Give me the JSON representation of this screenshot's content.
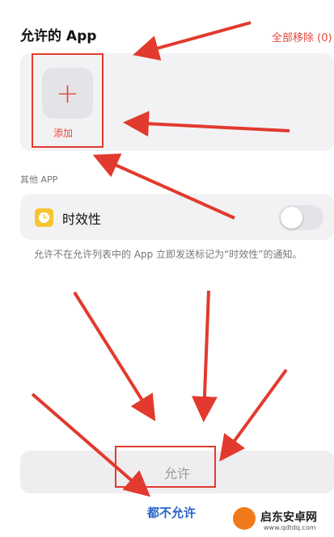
{
  "allowed_apps": {
    "title": "允许的 App",
    "remove_all_label": "全部移除 (0)",
    "add_button_symbol": "+",
    "add_label": "添加"
  },
  "other_apps": {
    "title": "其他 APP",
    "time_sensitive_label": "时效性",
    "time_sensitive_enabled": false,
    "description": "允许不在允许列表中的 App 立即发送标记为“时效性”的通知。"
  },
  "actions": {
    "allow_label": "允许",
    "deny_label": "都不允许"
  },
  "watermark": {
    "brand": "启东安卓网",
    "url": "www.qdtdq.com"
  },
  "colors": {
    "accent_red": "#e5463a",
    "link_blue": "#2a63c8",
    "icon_yellow": "#f7c534",
    "annotation_red": "#e23a2e"
  }
}
